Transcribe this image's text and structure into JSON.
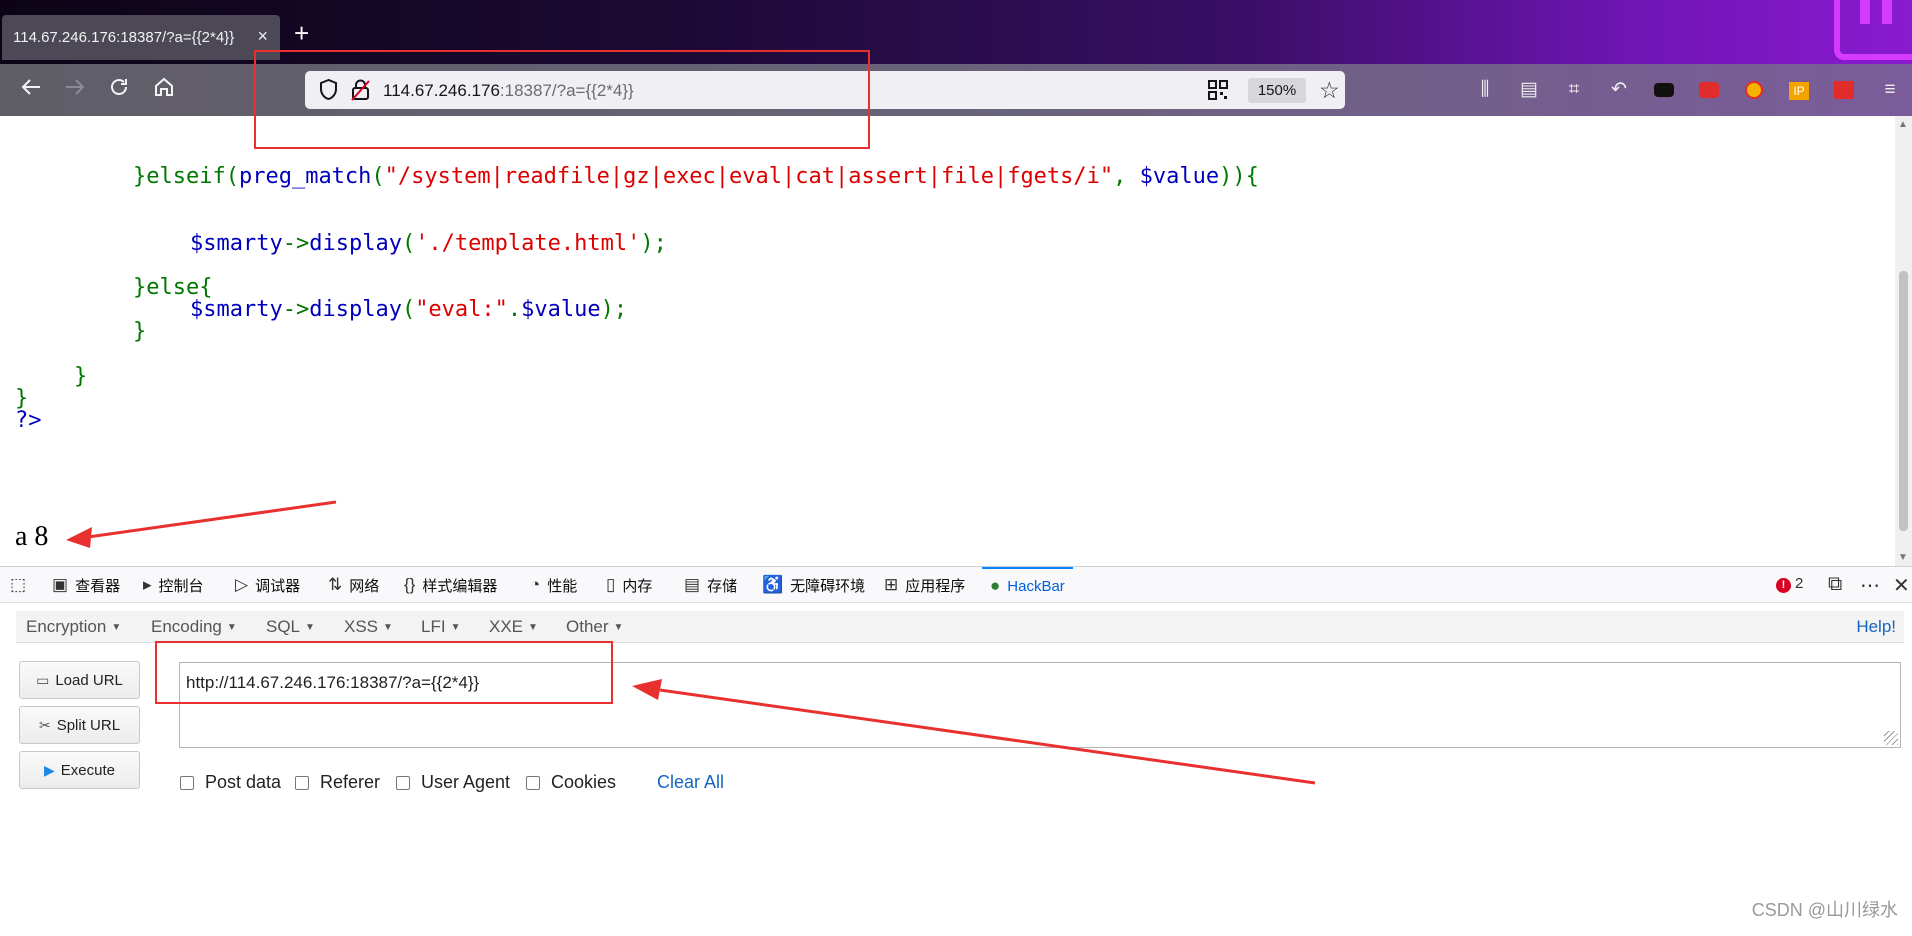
{
  "browser": {
    "tab_title": "114.67.246.176:18387/?a={{2*4}}",
    "tab_close": "×",
    "new_tab": "+",
    "url_host": "114.67.246.176",
    "url_rest": ":18387/?a={{2*4}}",
    "zoom": "150%"
  },
  "page": {
    "code": {
      "line1": {
        "a": "}elseif(",
        "b": "preg_match",
        "c": "(",
        "d": "\"/system|readfile|gz|exec|eval|cat|assert|file|fgets/i\"",
        "e": ", ",
        "f": "$value",
        "g": ")){"
      },
      "line2": {
        "a": "$smarty",
        "b": "->",
        "c": "display",
        "d": "(",
        "e": "'./template.html'",
        "f": ");"
      },
      "line3": "}else{",
      "line4": {
        "a": "$smarty",
        "b": "->",
        "c": "display",
        "d": "(",
        "e": "\"eval:\"",
        "f": ".",
        "g": "$value",
        "h": ");"
      },
      "line5": "}",
      "line6": "}",
      "line7": "}",
      "line8": "?>"
    },
    "output": "a 8"
  },
  "devtools": {
    "tabs": {
      "inspector": "查看器",
      "console": "控制台",
      "debugger": "调试器",
      "network": "网络",
      "style_editor": "样式编辑器",
      "performance": "性能",
      "memory": "内存",
      "storage": "存储",
      "accessibility": "无障碍环境",
      "application": "应用程序",
      "hackbar": "HackBar"
    },
    "error_count": "2"
  },
  "hackbar": {
    "menus": {
      "encryption": "Encryption",
      "encoding": "Encoding",
      "sql": "SQL",
      "xss": "XSS",
      "lfi": "LFI",
      "xxe": "XXE",
      "other": "Other"
    },
    "help": "Help!",
    "buttons": {
      "load_url": "Load URL",
      "split_url": "Split URL",
      "execute": "Execute"
    },
    "url_value": "http://114.67.246.176:18387/?a={{2*4}}",
    "options": {
      "post_data": "Post data",
      "referer": "Referer",
      "user_agent": "User Agent",
      "cookies": "Cookies"
    },
    "clear_all": "Clear All"
  },
  "watermark": "CSDN @山川绿水",
  "colors": {
    "annotation": "#e8312f",
    "code_green": "#007700",
    "code_blue": "#0000bb",
    "code_red": "#dd0000"
  }
}
